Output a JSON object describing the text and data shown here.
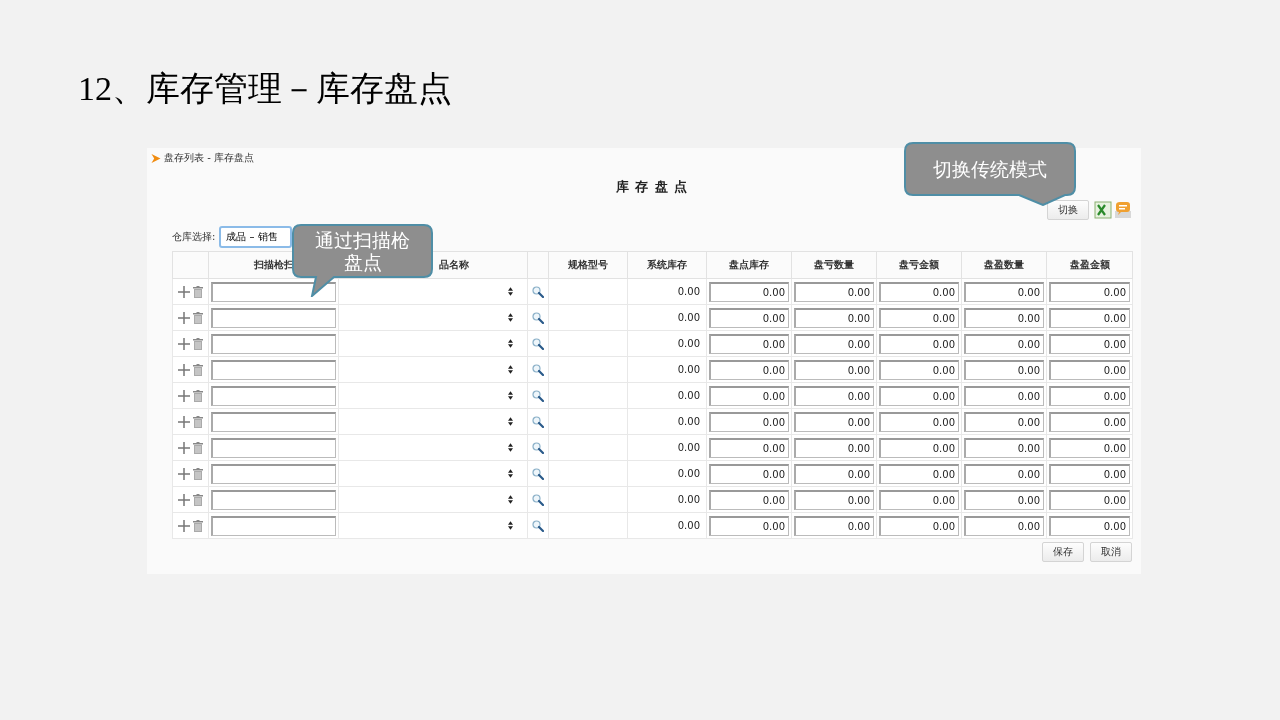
{
  "slide_title": "12、库存管理－库存盘点",
  "breadcrumb": "盘存列表 - 库存盘点",
  "page_title": "库 存 盘 点",
  "toolbar": {
    "switch_button": "切换"
  },
  "warehouse": {
    "label": "仓库选择:",
    "value": "成品 – 销售"
  },
  "table": {
    "columns": [
      "扫描枪扫",
      "品名称",
      "规格型号",
      "系统库存",
      "盘点库存",
      "盘亏数量",
      "盘亏金额",
      "盘盈数量",
      "盘盈金额"
    ],
    "rows": [
      {
        "system_stock": "0.00",
        "inputs": [
          "0.00",
          "0.00",
          "0.00",
          "0.00",
          "0.00"
        ]
      },
      {
        "system_stock": "0.00",
        "inputs": [
          "0.00",
          "0.00",
          "0.00",
          "0.00",
          "0.00"
        ]
      },
      {
        "system_stock": "0.00",
        "inputs": [
          "0.00",
          "0.00",
          "0.00",
          "0.00",
          "0.00"
        ]
      },
      {
        "system_stock": "0.00",
        "inputs": [
          "0.00",
          "0.00",
          "0.00",
          "0.00",
          "0.00"
        ]
      },
      {
        "system_stock": "0.00",
        "inputs": [
          "0.00",
          "0.00",
          "0.00",
          "0.00",
          "0.00"
        ]
      },
      {
        "system_stock": "0.00",
        "inputs": [
          "0.00",
          "0.00",
          "0.00",
          "0.00",
          "0.00"
        ]
      },
      {
        "system_stock": "0.00",
        "inputs": [
          "0.00",
          "0.00",
          "0.00",
          "0.00",
          "0.00"
        ]
      },
      {
        "system_stock": "0.00",
        "inputs": [
          "0.00",
          "0.00",
          "0.00",
          "0.00",
          "0.00"
        ]
      },
      {
        "system_stock": "0.00",
        "inputs": [
          "0.00",
          "0.00",
          "0.00",
          "0.00",
          "0.00"
        ]
      },
      {
        "system_stock": "0.00",
        "inputs": [
          "0.00",
          "0.00",
          "0.00",
          "0.00",
          "0.00"
        ]
      }
    ]
  },
  "buttons": [
    "保存",
    "取消"
  ],
  "callouts": [
    {
      "text": "通过扫描枪盘点"
    },
    {
      "text": "切换传统模式"
    }
  ]
}
